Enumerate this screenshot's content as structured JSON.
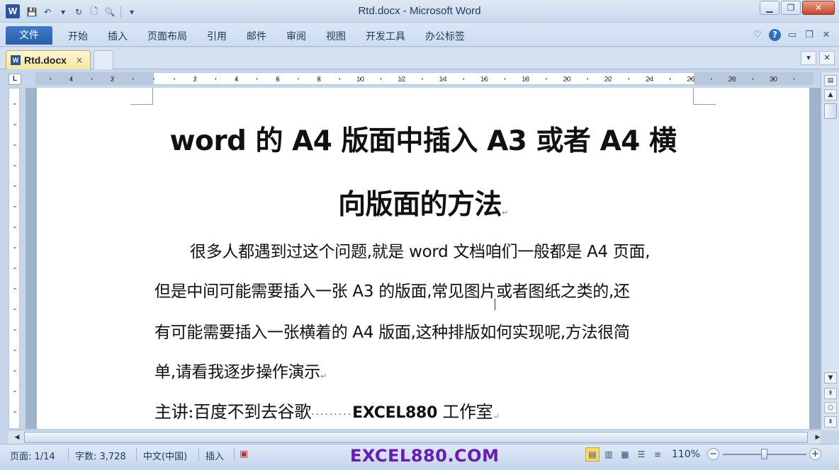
{
  "app": {
    "title": "Rtd.docx - Microsoft Word",
    "logo_letter": "W"
  },
  "quick_access": [
    {
      "icon": "save-icon",
      "glyph": "💾"
    },
    {
      "icon": "undo-icon",
      "glyph": "↶"
    },
    {
      "icon": "dropdown-icon",
      "glyph": "▾"
    },
    {
      "icon": "redo-icon",
      "glyph": "↻"
    },
    {
      "icon": "new-document-icon",
      "glyph": "🗋"
    },
    {
      "icon": "print-preview-icon",
      "glyph": "🔍"
    },
    {
      "icon": "customize-icon",
      "glyph": "▾"
    }
  ],
  "ribbon": {
    "file_tab": "文件",
    "tabs": [
      "开始",
      "插入",
      "页面布局",
      "引用",
      "邮件",
      "审阅",
      "视图",
      "开发工具",
      "办公标签"
    ]
  },
  "doc_tabs": {
    "active_name": "Rtd.docx",
    "close_glyph": "×"
  },
  "ruler": {
    "corner": "L"
  },
  "document": {
    "title_line1": "word 的 A4 版面中插入 A3 或者 A4 横",
    "title_line2": "向版面的方法",
    "para_line1": "很多人都遇到过这个问题,就是 word 文档咱们一般都是 A4 页面,",
    "para_line2": "但是中间可能需要插入一张  A3  的版面,常见图片或者图纸之类的,还",
    "para_line3": "有可能需要插入一张横着的  A4  版面,这种排版如何实现呢,方法很简",
    "para_line4": "单,请看我逐步操作演示",
    "presenter_prefix": "主讲:百度不到去谷歌",
    "presenter_dots": "·········",
    "presenter_brand": "EXCEL880",
    "presenter_suffix": " 工作室",
    "para_mark": "↵"
  },
  "status_bar": {
    "page": "页面: 1/14",
    "words": "字数: 3,728",
    "language": "中文(中国)",
    "mode": "插入",
    "watermark": "EXCEL880.COM",
    "zoom": "110%",
    "zoom_level_percent": 110
  }
}
